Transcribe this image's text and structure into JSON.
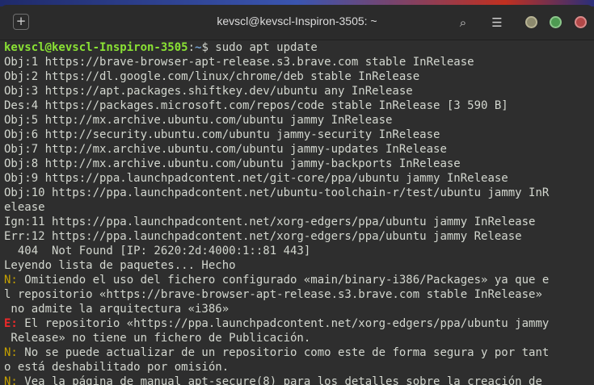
{
  "window": {
    "title": "kevscl@kevscl-Inspiron-3505: ~",
    "newtab_icon": "+",
    "search_icon": "⌕",
    "menu_icon": "☰"
  },
  "terminal": {
    "prompt_user": "kevscl@kevscl-Inspiron-3505",
    "prompt_sep": ":",
    "prompt_path": "~",
    "prompt_command": "$ sudo apt update",
    "lines": [
      "Obj:1 https://brave-browser-apt-release.s3.brave.com stable InRelease",
      "Obj:2 https://dl.google.com/linux/chrome/deb stable InRelease",
      "Obj:3 https://apt.packages.shiftkey.dev/ubuntu any InRelease",
      "Des:4 https://packages.microsoft.com/repos/code stable InRelease [3 590 B]",
      "Obj:5 http://mx.archive.ubuntu.com/ubuntu jammy InRelease",
      "Obj:6 http://security.ubuntu.com/ubuntu jammy-security InRelease",
      "Obj:7 http://mx.archive.ubuntu.com/ubuntu jammy-updates InRelease",
      "Obj:8 http://mx.archive.ubuntu.com/ubuntu jammy-backports InRelease",
      "Obj:9 https://ppa.launchpadcontent.net/git-core/ppa/ubuntu jammy InRelease",
      "Obj:10 https://ppa.launchpadcontent.net/ubuntu-toolchain-r/test/ubuntu jammy InR",
      "elease",
      "Ign:11 https://ppa.launchpadcontent.net/xorg-edgers/ppa/ubuntu jammy InRelease",
      "Err:12 https://ppa.launchpadcontent.net/xorg-edgers/ppa/ubuntu jammy Release",
      "  404  Not Found [IP: 2620:2d:4000:1::81 443]",
      "Leyendo lista de paquetes... Hecho"
    ],
    "messages": [
      {
        "tag": "N:",
        "kind": "n",
        "text": " Omitiendo el uso del fichero configurado «main/binary-i386/Packages» ya que e"
      },
      {
        "tag": "",
        "kind": "",
        "text": "l repositorio «https://brave-browser-apt-release.s3.brave.com stable InRelease»"
      },
      {
        "tag": "",
        "kind": "",
        "text": " no admite la arquitectura «i386»"
      },
      {
        "tag": "E:",
        "kind": "e",
        "text": " El repositorio «https://ppa.launchpadcontent.net/xorg-edgers/ppa/ubuntu jammy"
      },
      {
        "tag": "",
        "kind": "",
        "text": " Release» no tiene un fichero de Publicación."
      },
      {
        "tag": "N:",
        "kind": "n",
        "text": " No se puede actualizar de un repositorio como este de forma segura y por tant"
      },
      {
        "tag": "",
        "kind": "",
        "text": "o está deshabilitado por omisión."
      },
      {
        "tag": "N:",
        "kind": "n",
        "text": " Vea la página de manual apt-secure(8) para los detalles sobre la creación de"
      }
    ]
  },
  "colors": {
    "user": "#8ae234",
    "path": "#729fcf",
    "notice": "#c4a000",
    "error": "#ef2929",
    "text": "#d3d7cf",
    "background": "#2e2e2e"
  }
}
